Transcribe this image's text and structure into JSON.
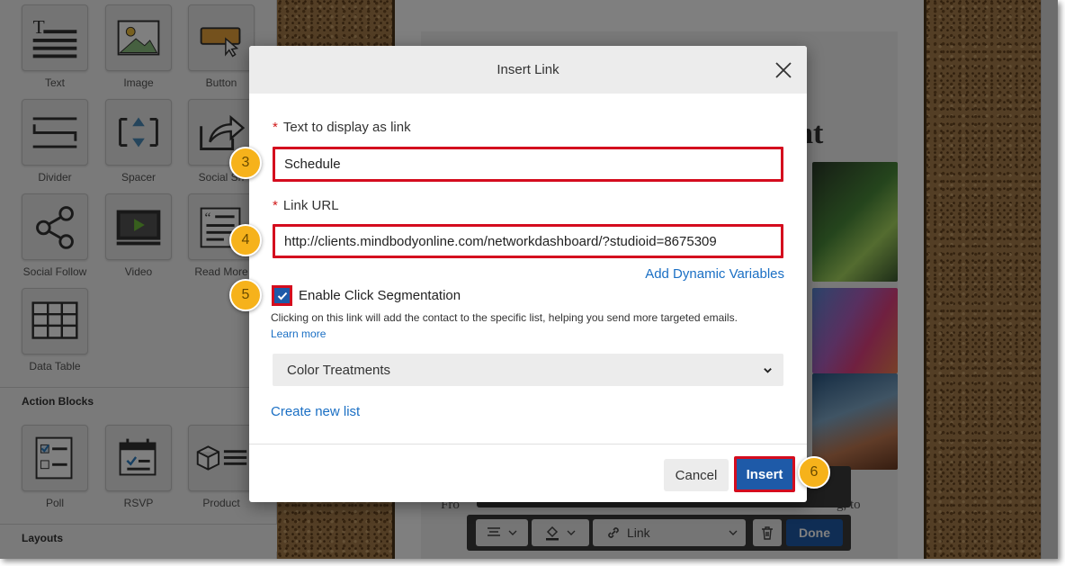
{
  "panel": {
    "blocks": [
      {
        "label": "Text",
        "icon": "text-icon"
      },
      {
        "label": "Image",
        "icon": "image-icon"
      },
      {
        "label": "Button",
        "icon": "button-icon"
      },
      {
        "label": "Divider",
        "icon": "divider-icon"
      },
      {
        "label": "Spacer",
        "icon": "spacer-icon"
      },
      {
        "label": "Social Sh",
        "icon": "share-icon"
      },
      {
        "label": "Social Follow",
        "icon": "social-follow-icon"
      },
      {
        "label": "Video",
        "icon": "video-icon"
      },
      {
        "label": "Read More",
        "icon": "read-more-icon"
      },
      {
        "label": "Data Table",
        "icon": "data-table-icon"
      }
    ],
    "action_blocks_title": "Action Blocks",
    "action_blocks": [
      {
        "label": "Poll",
        "icon": "poll-icon"
      },
      {
        "label": "RSVP",
        "icon": "rsvp-icon"
      },
      {
        "label": "Product",
        "icon": "product-icon"
      }
    ],
    "layouts_title": "Layouts"
  },
  "email": {
    "heading_fragment": "ent",
    "text_left": "Fro",
    "text_right": "g, to"
  },
  "toolbar": {
    "link_label": "Link",
    "done_label": "Done"
  },
  "dialog": {
    "title": "Insert Link",
    "required_mark": "*",
    "text_label": "Text to display as link",
    "text_value": "Schedule",
    "url_label": "Link URL",
    "url_value": "http://clients.mindbodyonline.com/networkdashboard/?studioid=8675309",
    "dynamic_vars": "Add Dynamic Variables",
    "segmentation_label": "Enable Click Segmentation",
    "segmentation_checked": true,
    "segmentation_desc": "Clicking on this link will add the contact to the specific list, helping you send more targeted emails.",
    "learn_more": "Learn more",
    "list_selected": "Color Treatments",
    "create_list": "Create new list",
    "cancel": "Cancel",
    "insert": "Insert"
  },
  "steps": [
    "3",
    "4",
    "5",
    "6"
  ],
  "colors": {
    "accent": "#1e5aa8",
    "highlight": "#d40c1e",
    "step_badge": "#f6b21b",
    "link": "#1a6fc4"
  }
}
